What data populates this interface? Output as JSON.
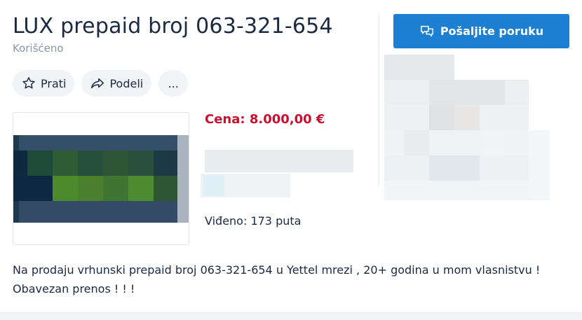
{
  "listing": {
    "title": "LUX prepaid broj 063-321-654",
    "condition": "Korišćeno",
    "price_text": "Cena: 8.000,00 €",
    "views_text": "Viđeno: 173 puta",
    "description_line1": "Na prodaju vrhunski prepaid broj 063-321-654 u Yettel mrezi , 20+ godina u mom vlasnistvu !",
    "description_line2": "Obavezan prenos ! ! !"
  },
  "actions": {
    "follow_label": "Prati",
    "share_label": "Podeli",
    "more_label": "..."
  },
  "seller_panel": {
    "send_message_label": "Pošaljite poruku"
  },
  "colors": {
    "title": "#1b2a44",
    "price": "#c8102e",
    "primary_button": "#1c7fd1",
    "pill_bg": "#f1f3f6",
    "muted": "#8a96a3"
  },
  "icons": {
    "follow": "star-icon",
    "share": "share-arrow-icon",
    "send": "chat-bubbles-icon"
  }
}
